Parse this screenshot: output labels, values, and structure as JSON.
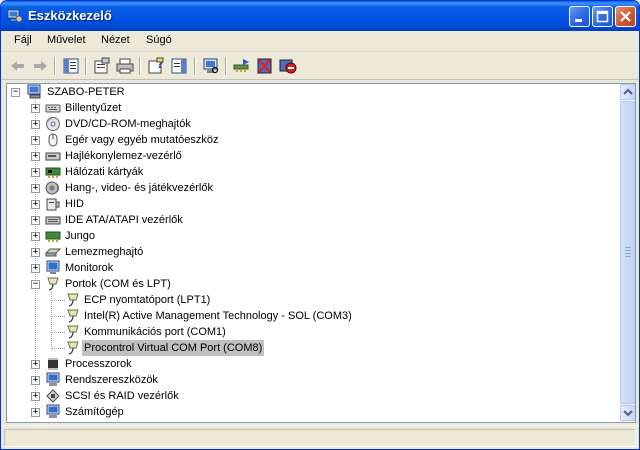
{
  "window": {
    "title": "Eszközkezelő"
  },
  "menu": [
    "Fájl",
    "Művelet",
    "Nézet",
    "Súgó"
  ],
  "toolbar": {
    "buttons": [
      "back-icon",
      "forward-icon",
      "console-tree-icon",
      "properties-icon",
      "print-icon",
      "help-icon",
      "action-pane-icon",
      "scan-hardware-icon",
      "update-driver-icon",
      "uninstall-icon",
      "disable-icon"
    ]
  },
  "tree": {
    "root": "SZABO-PETER",
    "items": [
      {
        "label": "Billentyűzet",
        "icon": "keyboard-icon",
        "expanded": false
      },
      {
        "label": "DVD/CD-ROM-meghajtók",
        "icon": "cdrom-icon",
        "expanded": false
      },
      {
        "label": "Egér vagy egyéb mutatóeszköz",
        "icon": "mouse-icon",
        "expanded": false
      },
      {
        "label": "Hajlékonylemez-vezérlő",
        "icon": "floppy-controller-icon",
        "expanded": false
      },
      {
        "label": "Hálózati kártyák",
        "icon": "network-card-icon",
        "expanded": false
      },
      {
        "label": "Hang-, video- és játékvezérlők",
        "icon": "sound-icon",
        "expanded": false
      },
      {
        "label": "HID",
        "icon": "hid-icon",
        "expanded": false
      },
      {
        "label": "IDE ATA/ATAPI vezérlők",
        "icon": "ide-icon",
        "expanded": false
      },
      {
        "label": "Jungo",
        "icon": "jungo-icon",
        "expanded": false
      },
      {
        "label": "Lemezmeghajtó",
        "icon": "disk-drive-icon",
        "expanded": false
      },
      {
        "label": "Monitorok",
        "icon": "monitor-icon",
        "expanded": false
      },
      {
        "label": "Portok (COM és LPT)",
        "icon": "port-icon",
        "expanded": true,
        "children": [
          {
            "label": "ECP nyomtatóport (LPT1)",
            "icon": "port-icon"
          },
          {
            "label": "Intel(R) Active Management Technology - SOL (COM3)",
            "icon": "port-icon"
          },
          {
            "label": "Kommunikációs port (COM1)",
            "icon": "port-icon"
          },
          {
            "label": "Procontrol Virtual COM Port (COM8)",
            "icon": "port-icon",
            "selected": true
          }
        ]
      },
      {
        "label": "Processzorok",
        "icon": "processor-icon",
        "expanded": false
      },
      {
        "label": "Rendszereszközök",
        "icon": "system-device-icon",
        "expanded": false
      },
      {
        "label": "SCSI és RAID vezérlők",
        "icon": "scsi-icon",
        "expanded": false
      },
      {
        "label": "Számítógép",
        "icon": "computer-icon",
        "expanded": false
      }
    ]
  },
  "colors": {
    "titlebar": "#0055E5",
    "selection": "#C0C0C0",
    "border": "#7F9DB9"
  }
}
